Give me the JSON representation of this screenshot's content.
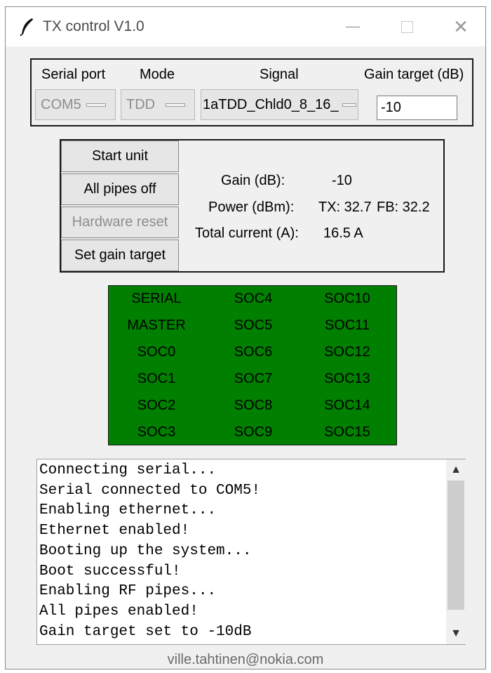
{
  "window": {
    "title": "TX control V1.0",
    "icon": "feather-icon",
    "controls": {
      "minimize": "minimize-icon",
      "maximize": "maximize-icon",
      "close": "close-icon",
      "close_glyph": "✕"
    }
  },
  "config": {
    "serial_port": {
      "label": "Serial port",
      "value": "COM5",
      "state": "disabled"
    },
    "mode": {
      "label": "Mode",
      "value": "TDD",
      "state": "disabled"
    },
    "signal": {
      "label": "Signal",
      "value": "1aTDD_Chld0_8_16_"
    },
    "gain_target": {
      "label": "Gain target (dB)",
      "value": "-10"
    }
  },
  "actions": {
    "start_unit": "Start unit",
    "all_pipes_off": "All pipes off",
    "hardware_reset": "Hardware reset",
    "set_gain_target": "Set gain target"
  },
  "readouts": {
    "gain_label": "Gain (dB):",
    "gain_value": "-10",
    "power_label": "Power (dBm):",
    "power_tx": "TX: 32.7",
    "power_fb": "FB: 32.2",
    "current_label": "Total current (A):",
    "current_value": "16.5 A"
  },
  "status_panel": {
    "background": "#007f00",
    "columns": [
      [
        "SERIAL",
        "MASTER",
        "SOC0",
        "SOC1",
        "SOC2",
        "SOC3"
      ],
      [
        "SOC4",
        "SOC5",
        "SOC6",
        "SOC7",
        "SOC8",
        "SOC9"
      ],
      [
        "SOC10",
        "SOC11",
        "SOC12",
        "SOC13",
        "SOC14",
        "SOC15"
      ]
    ]
  },
  "log": [
    "Connecting serial...",
    "Serial connected to COM5!",
    "Enabling ethernet...",
    "Ethernet enabled!",
    "Booting up the system...",
    "Boot successful!",
    "Enabling RF pipes...",
    "All pipes enabled!",
    "Gain target set to -10dB"
  ],
  "scrollbar": {
    "up": "▲",
    "down": "▼"
  },
  "footer": "ville.tahtinen@nokia.com"
}
